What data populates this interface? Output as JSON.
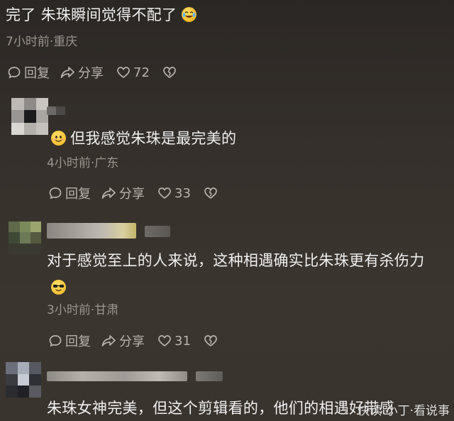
{
  "comments": [
    {
      "text": "完了 朱珠瞬间觉得不配了",
      "emoji": "crying-laughing-emoji",
      "meta": "7小时前·重庆",
      "reply_label": "回复",
      "share_label": "分享",
      "likes": "72"
    },
    {
      "text": "但我感觉朱珠是最完美的",
      "emoji": "smiling-emoji",
      "meta": "4小时前·广东",
      "reply_label": "回复",
      "share_label": "分享",
      "likes": "33"
    },
    {
      "text": "对于感觉至上的人来说，这种相遇确实比朱珠更有杀伤力",
      "emoji": "sunglasses-emoji",
      "meta": "3小时前·甘肃",
      "reply_label": "回复",
      "share_label": "分享",
      "likes": "31"
    },
    {
      "text": "朱珠女神完美，但这个剪辑看的，他们的相遇好带感",
      "meta": ""
    }
  ],
  "watermark": "快读·小丁·看说事",
  "colors": {
    "text": "#f0f0f0",
    "meta": "#9a958f",
    "icon": "#b8b3ad"
  }
}
